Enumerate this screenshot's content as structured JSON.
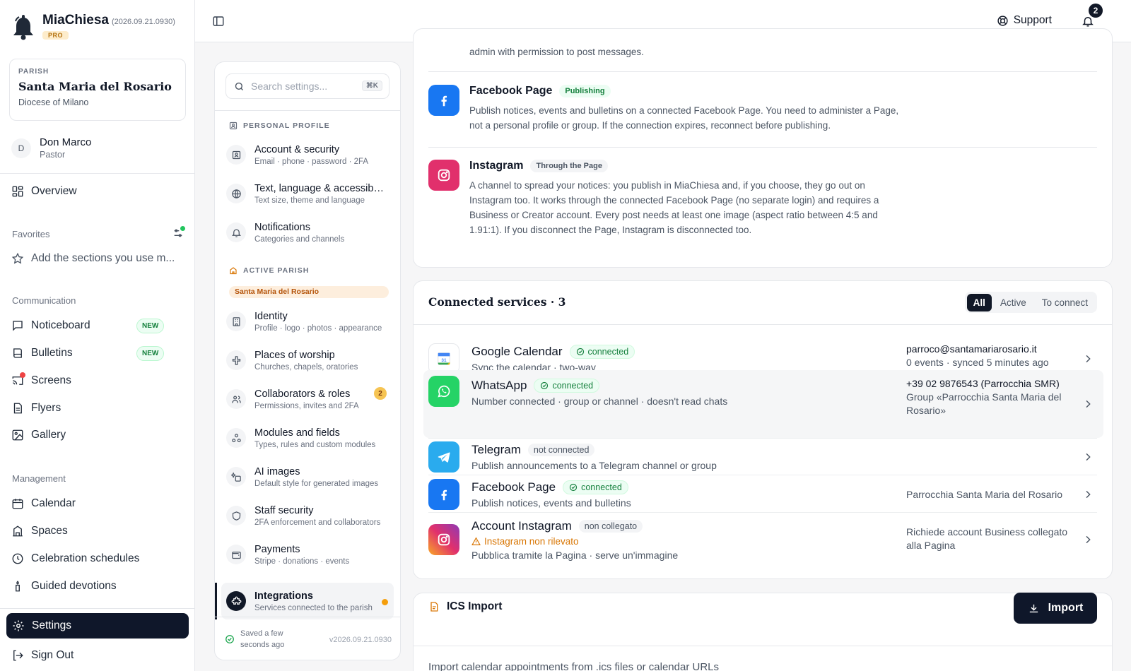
{
  "brand": {
    "name": "MiaChiesa",
    "version": "(2026.09.21.0930)",
    "tier": "PRO"
  },
  "parish": {
    "label": "PARISH",
    "name": "Santa Maria del Rosario",
    "diocese": "Diocese of Milano"
  },
  "user": {
    "initial": "D",
    "name": "Don Marco",
    "role": "Pastor"
  },
  "sidebar": {
    "overview": "Overview",
    "favorites_label": "Favorites",
    "favorites_hint": "Add the sections you use m...",
    "communication_label": "Communication",
    "communication": [
      {
        "label": "Noticeboard",
        "badge": "NEW"
      },
      {
        "label": "Bulletins",
        "badge": "NEW"
      },
      {
        "label": "Screens"
      },
      {
        "label": "Flyers"
      },
      {
        "label": "Gallery"
      }
    ],
    "management_label": "Management",
    "management": [
      {
        "label": "Calendar"
      },
      {
        "label": "Spaces"
      },
      {
        "label": "Celebration schedules"
      },
      {
        "label": "Guided devotions"
      }
    ],
    "settings": "Settings",
    "signout": "Sign Out"
  },
  "topbar": {
    "support": "Support",
    "notifications_count": "2"
  },
  "settings_nav": {
    "search_placeholder": "Search settings...",
    "search_kbd": "⌘K",
    "personal_label": "PERSONAL PROFILE",
    "personal": [
      {
        "title": "Account & security",
        "sub": "Email · phone · password · 2FA"
      },
      {
        "title": "Text, language & accessibility",
        "sub": "Text size, theme and language"
      },
      {
        "title": "Notifications",
        "sub": "Categories and channels"
      }
    ],
    "parish_label": "ACTIVE PARISH",
    "parish_chip": "Santa Maria del Rosario",
    "parish_items": [
      {
        "title": "Identity",
        "sub": "Profile · logo · photos · appearance"
      },
      {
        "title": "Places of worship",
        "sub": "Churches, chapels, oratories"
      },
      {
        "title": "Collaborators & roles",
        "sub": "Permissions, invites and 2FA",
        "count": "2"
      },
      {
        "title": "Modules and fields",
        "sub": "Types, rules and custom modules"
      },
      {
        "title": "AI images",
        "sub": "Default style for generated images"
      },
      {
        "title": "Staff security",
        "sub": "2FA enforcement and collaborators"
      },
      {
        "title": "Payments",
        "sub": "Stripe · donations · events"
      },
      {
        "title": "Integrations",
        "sub": "Services connected to the parish"
      }
    ],
    "saved_text": "Saved a few seconds ago",
    "version": "v2026.09.21.0930"
  },
  "channels": {
    "top_text": "admin with permission to post messages.",
    "facebook": {
      "title": "Facebook Page",
      "badge": "Publishing",
      "desc": "Publish notices, events and bulletins on a connected Facebook Page. You need to administer a Page, not a personal profile or group. If the connection expires, reconnect before publishing."
    },
    "instagram": {
      "title": "Instagram",
      "badge": "Through the Page",
      "desc": "A channel to spread your notices: you publish in MiaChiesa and, if you choose, they go out on Instagram too. It works through the connected Facebook Page (no separate login) and requires a Business or Creator account. Every post needs at least one image (aspect ratio between 4:5 and 1.91:1). If you disconnect the Page, Instagram is disconnected too."
    }
  },
  "connected": {
    "title": "Connected services · 3",
    "filters": [
      "All",
      "Active",
      "To connect"
    ],
    "services": [
      {
        "name": "Google Calendar",
        "status": "connected",
        "sub": "Sync the calendar · two-way",
        "right1": "parroco@santamariarosario.it",
        "right2": "0 events · synced 5 minutes ago"
      },
      {
        "name": "WhatsApp",
        "status": "connected",
        "sub": "Number connected · group or channel · doesn't read chats",
        "right1": "+39 02 9876543 (Parrocchia SMR)",
        "right2": "Group «Parrocchia Santa Maria del Rosario»"
      },
      {
        "name": "Telegram",
        "status": "not connected",
        "sub": "Publish announcements to a Telegram channel or group"
      },
      {
        "name": "Facebook Page",
        "status": "connected",
        "sub": "Publish notices, events and bulletins",
        "right1": "Parrocchia Santa Maria del Rosario"
      },
      {
        "name": "Account Instagram",
        "status": "non collegato",
        "warn": "Instagram non rilevato",
        "sub": "Pubblica tramite la Pagina · serve un'immagine",
        "right1": "Richiede account Business collegato alla Pagina"
      }
    ]
  },
  "ics": {
    "title": "ICS Import",
    "button": "Import",
    "desc": "Import calendar appointments from .ics files or calendar URLs"
  }
}
